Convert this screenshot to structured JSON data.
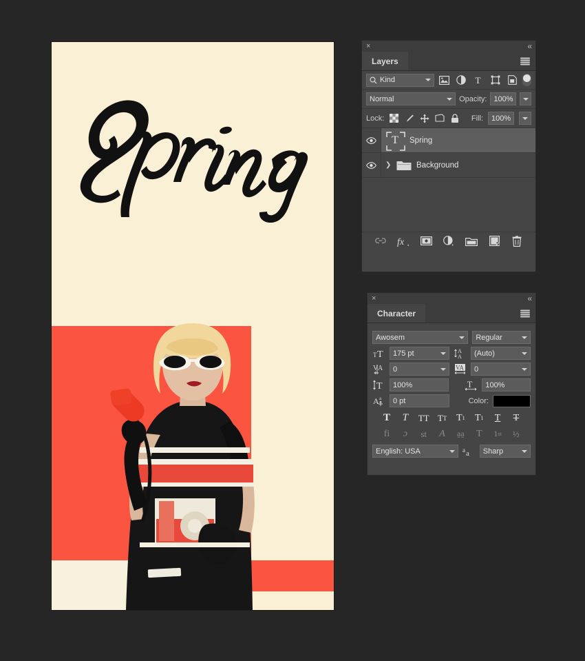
{
  "app": {
    "background_color": "#262626"
  },
  "canvas": {
    "name": "artwork-canvas",
    "headline": "Spring",
    "colors": {
      "cream": "#faf0d5",
      "red": "#fb5542",
      "black": "#151515",
      "bottom_cream": "#f7f1dd"
    },
    "photo_description": "Woman with blonde bob, white cat-eye sunglasses, black gloves holding a red rotary telephone"
  },
  "layers_panel": {
    "title": "Layers",
    "close_label": "×",
    "collapse_label": "«",
    "menu_label": "panel-menu",
    "filter": {
      "kind_label": "Kind",
      "search_icon": "search-icon",
      "type_filters": [
        {
          "name": "filter-pixel-layers",
          "icon": "image-icon"
        },
        {
          "name": "filter-adjustment-layers",
          "icon": "adjustment-icon"
        },
        {
          "name": "filter-type-layers",
          "icon": "type-icon"
        },
        {
          "name": "filter-shape-layers",
          "icon": "shape-icon"
        },
        {
          "name": "filter-smart-objects",
          "icon": "smart-object-icon"
        }
      ],
      "toggle_name": "filter-enable-toggle"
    },
    "blend": {
      "mode": "Normal",
      "opacity_label": "Opacity:",
      "opacity_value": "100%"
    },
    "lock": {
      "label": "Lock:",
      "buttons": [
        {
          "name": "lock-transparent-pixels",
          "icon": "checkerboard-icon"
        },
        {
          "name": "lock-image-pixels",
          "icon": "brush-icon"
        },
        {
          "name": "lock-position",
          "icon": "move-arrows-icon"
        },
        {
          "name": "lock-artboard-nesting",
          "icon": "artboard-icon"
        },
        {
          "name": "lock-all",
          "icon": "lock-icon"
        }
      ],
      "fill_label": "Fill:",
      "fill_value": "100%"
    },
    "layers": [
      {
        "name": "Spring",
        "type": "text",
        "visible": true,
        "selected": true,
        "thumb_glyph": "T"
      },
      {
        "name": "Background",
        "type": "group",
        "visible": true,
        "selected": false,
        "thumb_glyph": "folder",
        "expandable": true
      }
    ],
    "bottom_buttons": [
      {
        "name": "link-layers-button",
        "icon": "link-icon"
      },
      {
        "name": "layer-style-button",
        "icon": "fx-icon",
        "label": "fx"
      },
      {
        "name": "add-layer-mask-button",
        "icon": "mask-icon"
      },
      {
        "name": "new-adjustment-layer-button",
        "icon": "adjustment-icon"
      },
      {
        "name": "new-group-button",
        "icon": "folder-icon"
      },
      {
        "name": "new-layer-button",
        "icon": "new-layer-icon"
      },
      {
        "name": "delete-layer-button",
        "icon": "trash-icon"
      }
    ]
  },
  "character_panel": {
    "title": "Character",
    "close_label": "×",
    "collapse_label": "«",
    "font_family": "Awosem",
    "font_style": "Regular",
    "font_size": "175 pt",
    "leading": "(Auto)",
    "kerning": "0",
    "tracking": "0",
    "vertical_scale": "100%",
    "horizontal_scale": "100%",
    "baseline_shift": "0 pt",
    "color_label": "Color:",
    "color_value": "#000000",
    "language": "English: USA",
    "antialias": "Sharp",
    "antialias_icon": "aa-icon",
    "style_buttons": [
      {
        "name": "faux-bold-button",
        "glyph": "T",
        "style": "bold"
      },
      {
        "name": "faux-italic-button",
        "glyph": "T",
        "style": "italic"
      },
      {
        "name": "all-caps-button",
        "glyph": "TT"
      },
      {
        "name": "small-caps-button",
        "glyph": "Tᴛ"
      },
      {
        "name": "superscript-button",
        "glyph": "T¹"
      },
      {
        "name": "subscript-button",
        "glyph": "T₁"
      },
      {
        "name": "underline-button",
        "glyph": "T"
      },
      {
        "name": "strikethrough-button",
        "glyph": "T"
      }
    ],
    "opentype_buttons": [
      {
        "name": "standard-ligatures-button",
        "glyph": "fi"
      },
      {
        "name": "contextual-alternates-button",
        "glyph": "ɔͤ"
      },
      {
        "name": "discretionary-ligatures-button",
        "glyph": "st"
      },
      {
        "name": "swash-button",
        "glyph": "𝒜"
      },
      {
        "name": "stylistic-alternates-button",
        "glyph": "aa"
      },
      {
        "name": "titling-alternates-button",
        "glyph": "T"
      },
      {
        "name": "ordinals-button",
        "glyph": "1st"
      },
      {
        "name": "fractions-button",
        "glyph": "½"
      }
    ],
    "metric_icons": {
      "size": "font-size-icon",
      "leading": "leading-icon",
      "kerning": "kerning-icon",
      "tracking": "tracking-icon",
      "vscale": "vertical-scale-icon",
      "hscale": "horizontal-scale-icon",
      "baseline": "baseline-shift-icon"
    }
  }
}
